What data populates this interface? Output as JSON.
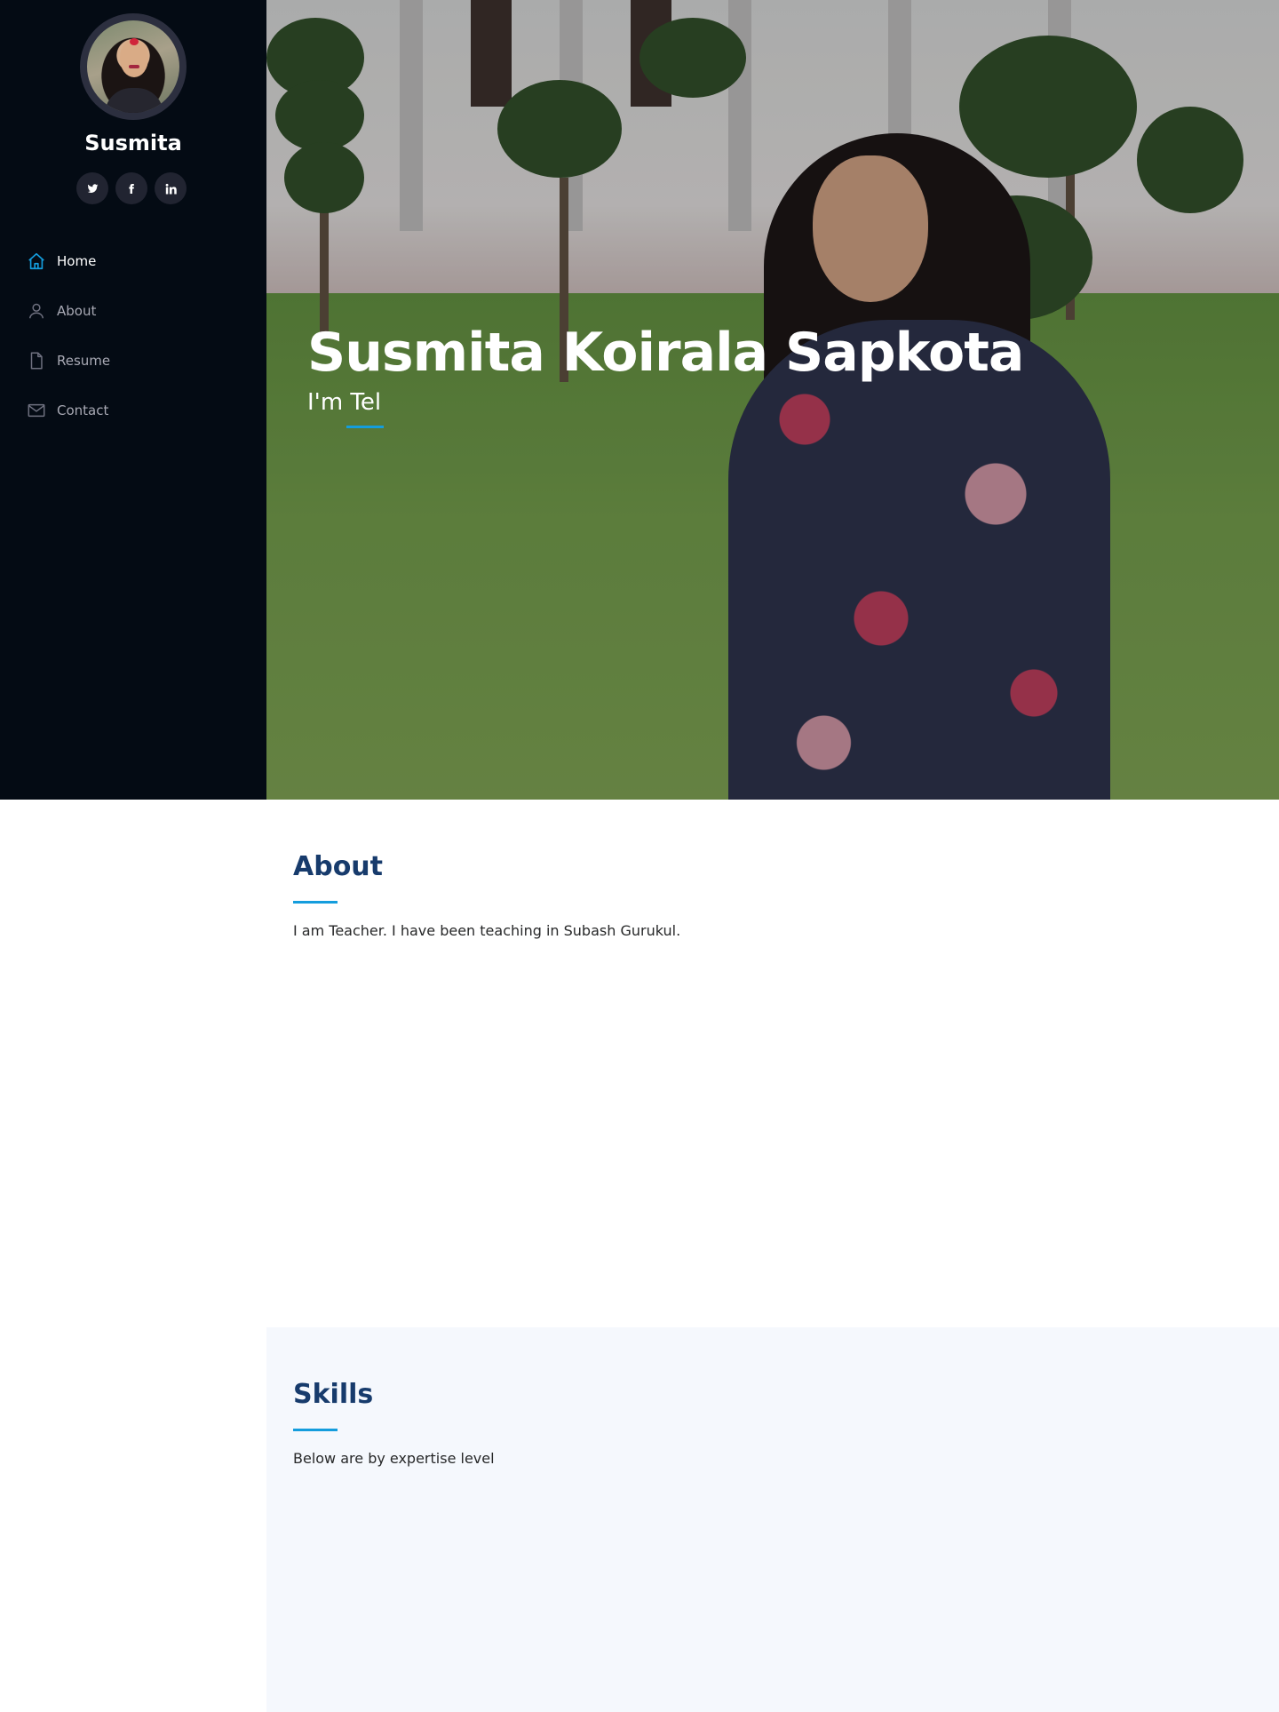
{
  "sidebar": {
    "profile_name": "Susmita",
    "social": [
      {
        "icon": "twitter-icon",
        "glyph": "𝙩"
      },
      {
        "icon": "facebook-icon",
        "glyph": "f"
      },
      {
        "icon": "linkedin-icon",
        "glyph": "in"
      }
    ],
    "nav": [
      {
        "label": "Home",
        "icon": "home-icon",
        "active": true
      },
      {
        "label": "About",
        "icon": "user-icon",
        "active": false
      },
      {
        "label": "Resume",
        "icon": "file-icon",
        "active": false
      },
      {
        "label": "Contact",
        "icon": "envelope-icon",
        "active": false
      }
    ]
  },
  "hero": {
    "title": "Susmita Koirala Sapkota",
    "subtitle": "I'm Tel"
  },
  "about": {
    "title": "About",
    "text": "I am Teacher. I have been teaching in Subash Gurukul."
  },
  "skills": {
    "title": "Skills",
    "text": "Below are by expertise level"
  },
  "colors": {
    "sidebar_bg": "#040b14",
    "accent": "#149ddd",
    "heading": "#173b6c",
    "skills_bg": "#f5f8fd"
  }
}
